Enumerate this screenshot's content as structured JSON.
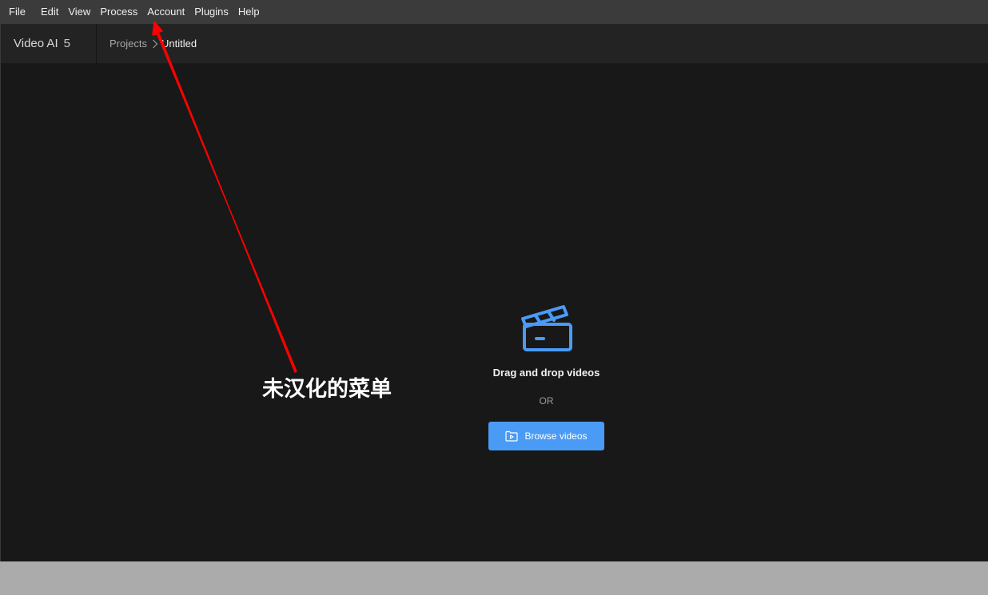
{
  "menubar": {
    "items": [
      "File",
      "Edit",
      "View",
      "Process",
      "Account",
      "Plugins",
      "Help"
    ]
  },
  "header": {
    "app_name": "Video AI",
    "app_version": "5",
    "breadcrumb": {
      "parent": "Projects",
      "current": "Untitled"
    }
  },
  "dropzone": {
    "icon": "clapperboard-icon",
    "title": "Drag and drop videos",
    "or_label": "OR",
    "browse_label": "Browse videos",
    "browse_icon": "folder-video-icon"
  },
  "annotation": {
    "text": "未汉化的菜单",
    "color": "#ff0000"
  },
  "colors": {
    "accent": "#4a9bf5",
    "background": "#181818",
    "menubar": "#3b3b3b",
    "header": "#232323"
  }
}
